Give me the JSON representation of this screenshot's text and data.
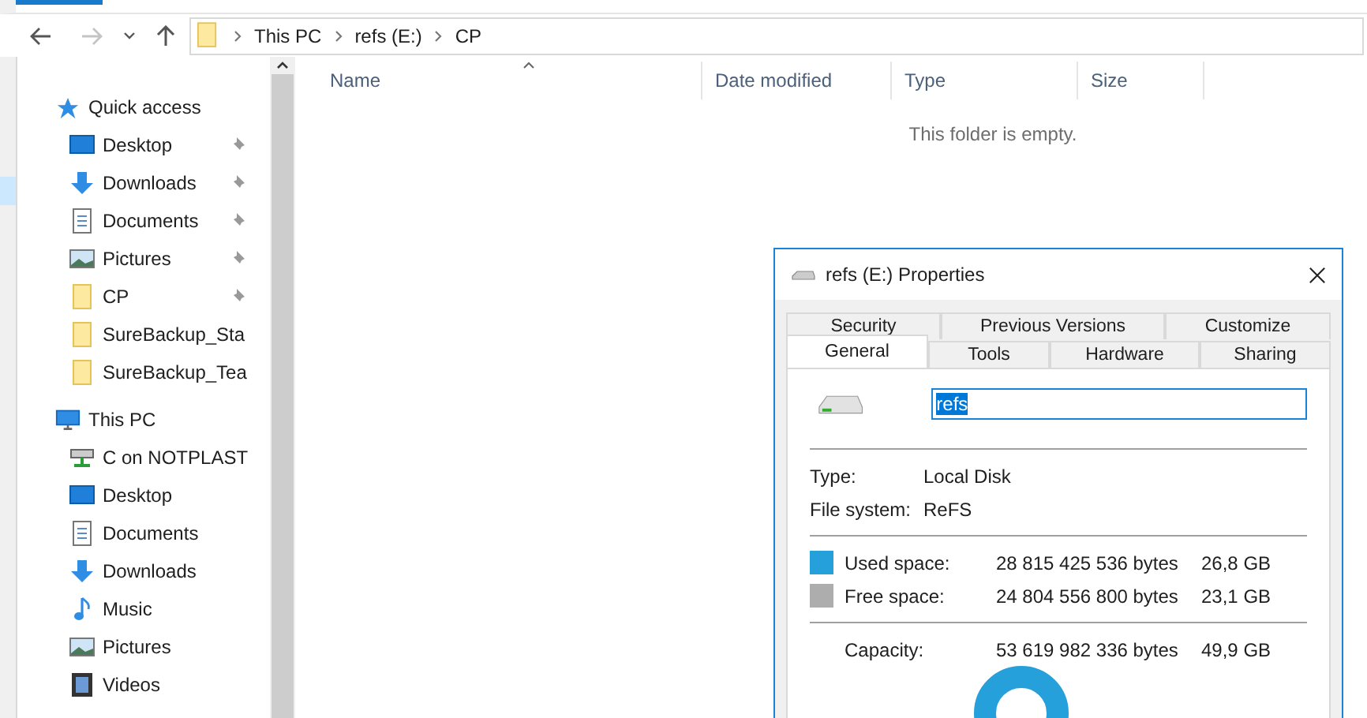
{
  "navigation": {
    "back_disabled": false,
    "forward_disabled": true
  },
  "address_bar": {
    "path": [
      "This PC",
      "refs (E:)",
      "CP"
    ]
  },
  "sidebar": {
    "groups": [
      {
        "label": "Quick access",
        "kind": "star",
        "items": [
          {
            "label": "Desktop",
            "kind": "desktop",
            "pinned": true
          },
          {
            "label": "Downloads",
            "kind": "downloads",
            "pinned": true
          },
          {
            "label": "Documents",
            "kind": "documents",
            "pinned": true
          },
          {
            "label": "Pictures",
            "kind": "pictures",
            "pinned": true
          },
          {
            "label": "CP",
            "kind": "folder",
            "pinned": true
          },
          {
            "label": "SureBackup_Sta",
            "kind": "folder",
            "pinned": false
          },
          {
            "label": "SureBackup_Tea",
            "kind": "folder",
            "pinned": false
          }
        ]
      },
      {
        "label": "This PC",
        "kind": "computer",
        "items": [
          {
            "label": "C on NOTPLAST",
            "kind": "network-drive",
            "pinned": false
          },
          {
            "label": "Desktop",
            "kind": "desktop",
            "pinned": false
          },
          {
            "label": "Documents",
            "kind": "documents",
            "pinned": false
          },
          {
            "label": "Downloads",
            "kind": "downloads",
            "pinned": false
          },
          {
            "label": "Music",
            "kind": "music",
            "pinned": false
          },
          {
            "label": "Pictures",
            "kind": "pictures",
            "pinned": false
          },
          {
            "label": "Videos",
            "kind": "videos",
            "pinned": false
          }
        ]
      }
    ]
  },
  "file_list": {
    "columns": [
      "Name",
      "Date modified",
      "Type",
      "Size"
    ],
    "empty_message": "This folder is empty."
  },
  "dialog": {
    "title": "refs (E:) Properties",
    "tab_rows": [
      [
        {
          "label": "Security",
          "selected": false
        },
        {
          "label": "Previous Versions",
          "selected": false
        },
        {
          "label": "Customize",
          "selected": false
        }
      ],
      [
        {
          "label": "General",
          "selected": true
        },
        {
          "label": "Tools",
          "selected": false
        },
        {
          "label": "Hardware",
          "selected": false
        },
        {
          "label": "Sharing",
          "selected": false
        }
      ]
    ],
    "volume_label": "refs",
    "properties": [
      {
        "label": "Type:",
        "value": "Local Disk"
      },
      {
        "label": "File system:",
        "value": "ReFS"
      }
    ],
    "space": [
      {
        "label": "Used space:",
        "bytes": "28 815 425 536 bytes",
        "size": "26,8 GB",
        "color": "#26a0da"
      },
      {
        "label": "Free space:",
        "bytes": "24 804 556 800 bytes",
        "size": "23,1 GB",
        "color": "#adadad"
      }
    ],
    "capacity": {
      "label": "Capacity:",
      "bytes": "53 619 982 336 bytes",
      "size": "49,9 GB"
    }
  }
}
